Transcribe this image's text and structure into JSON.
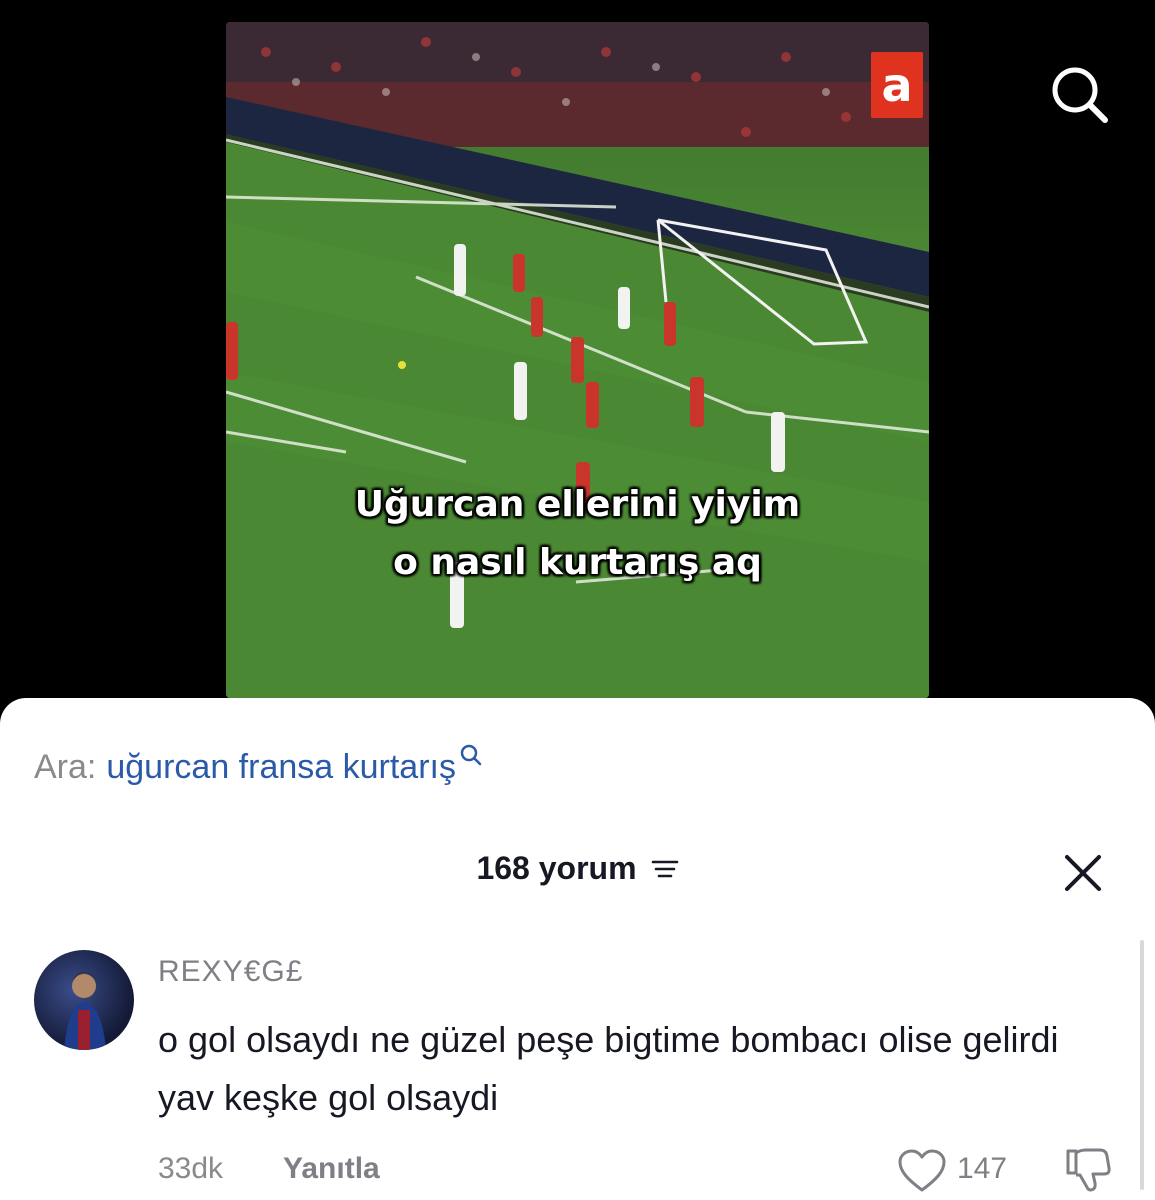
{
  "video": {
    "caption_line1": "Uğurcan ellerini yiyim",
    "caption_line2": "o nasıl kurtarış aq",
    "channel_logo": "a",
    "search_icon": "search-icon"
  },
  "search_suggestion": {
    "prefix": "Ara:",
    "query": "uğurcan fransa kurtarış",
    "icon": "search-icon"
  },
  "comments": {
    "count_label": "168 yorum",
    "filter_icon": "filter-icon",
    "close_icon": "close-icon",
    "items": [
      {
        "username": "REXY€G£",
        "text": "o gol olsaydı ne güzel peşe bigtime bombacı olise gelirdi yav keşke gol olsaydi",
        "time": "33dk",
        "reply_label": "Yanıtla",
        "likes": "147",
        "like_icon": "heart-icon",
        "dislike_icon": "thumbs-down-icon"
      }
    ]
  },
  "colors": {
    "link_blue": "#2b5aa8",
    "text_dark": "#161823",
    "text_gray": "#8a8a8a",
    "pitch_green": "#4c8a34",
    "logo_red": "#e0331f"
  }
}
